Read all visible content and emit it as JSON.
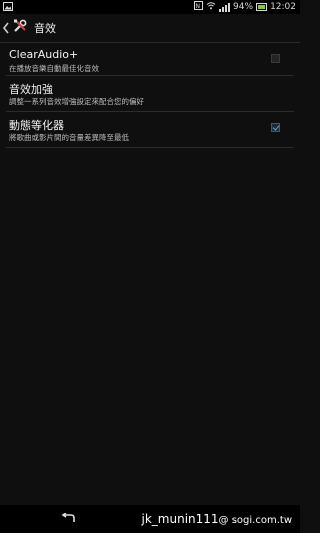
{
  "status_bar": {
    "battery": "94%",
    "time": "12:02",
    "icons": [
      "image-icon",
      "nfc-icon",
      "wifi-icon",
      "signal-icon",
      "battery-icon"
    ]
  },
  "action_bar": {
    "title": "音效",
    "icons": [
      "back-chevron-icon",
      "tools-icon"
    ]
  },
  "settings": [
    {
      "title": "ClearAudio+",
      "subtitle": "在播放音樂自動最佳化音效",
      "checked": false
    },
    {
      "title": "音效加強",
      "subtitle": "調整一系列音效增強設定來配合您的偏好",
      "checked": null
    },
    {
      "title": "動態等化器",
      "subtitle": "將歌曲或影片間的音量差異降至最低",
      "checked": true
    }
  ],
  "nav_bar": {
    "watermark_user": "jk_munin111",
    "watermark_site": "@ sogi.com.tw"
  },
  "colors": {
    "background": "#0f0f0f",
    "accent_check": "#4fa8e0"
  }
}
